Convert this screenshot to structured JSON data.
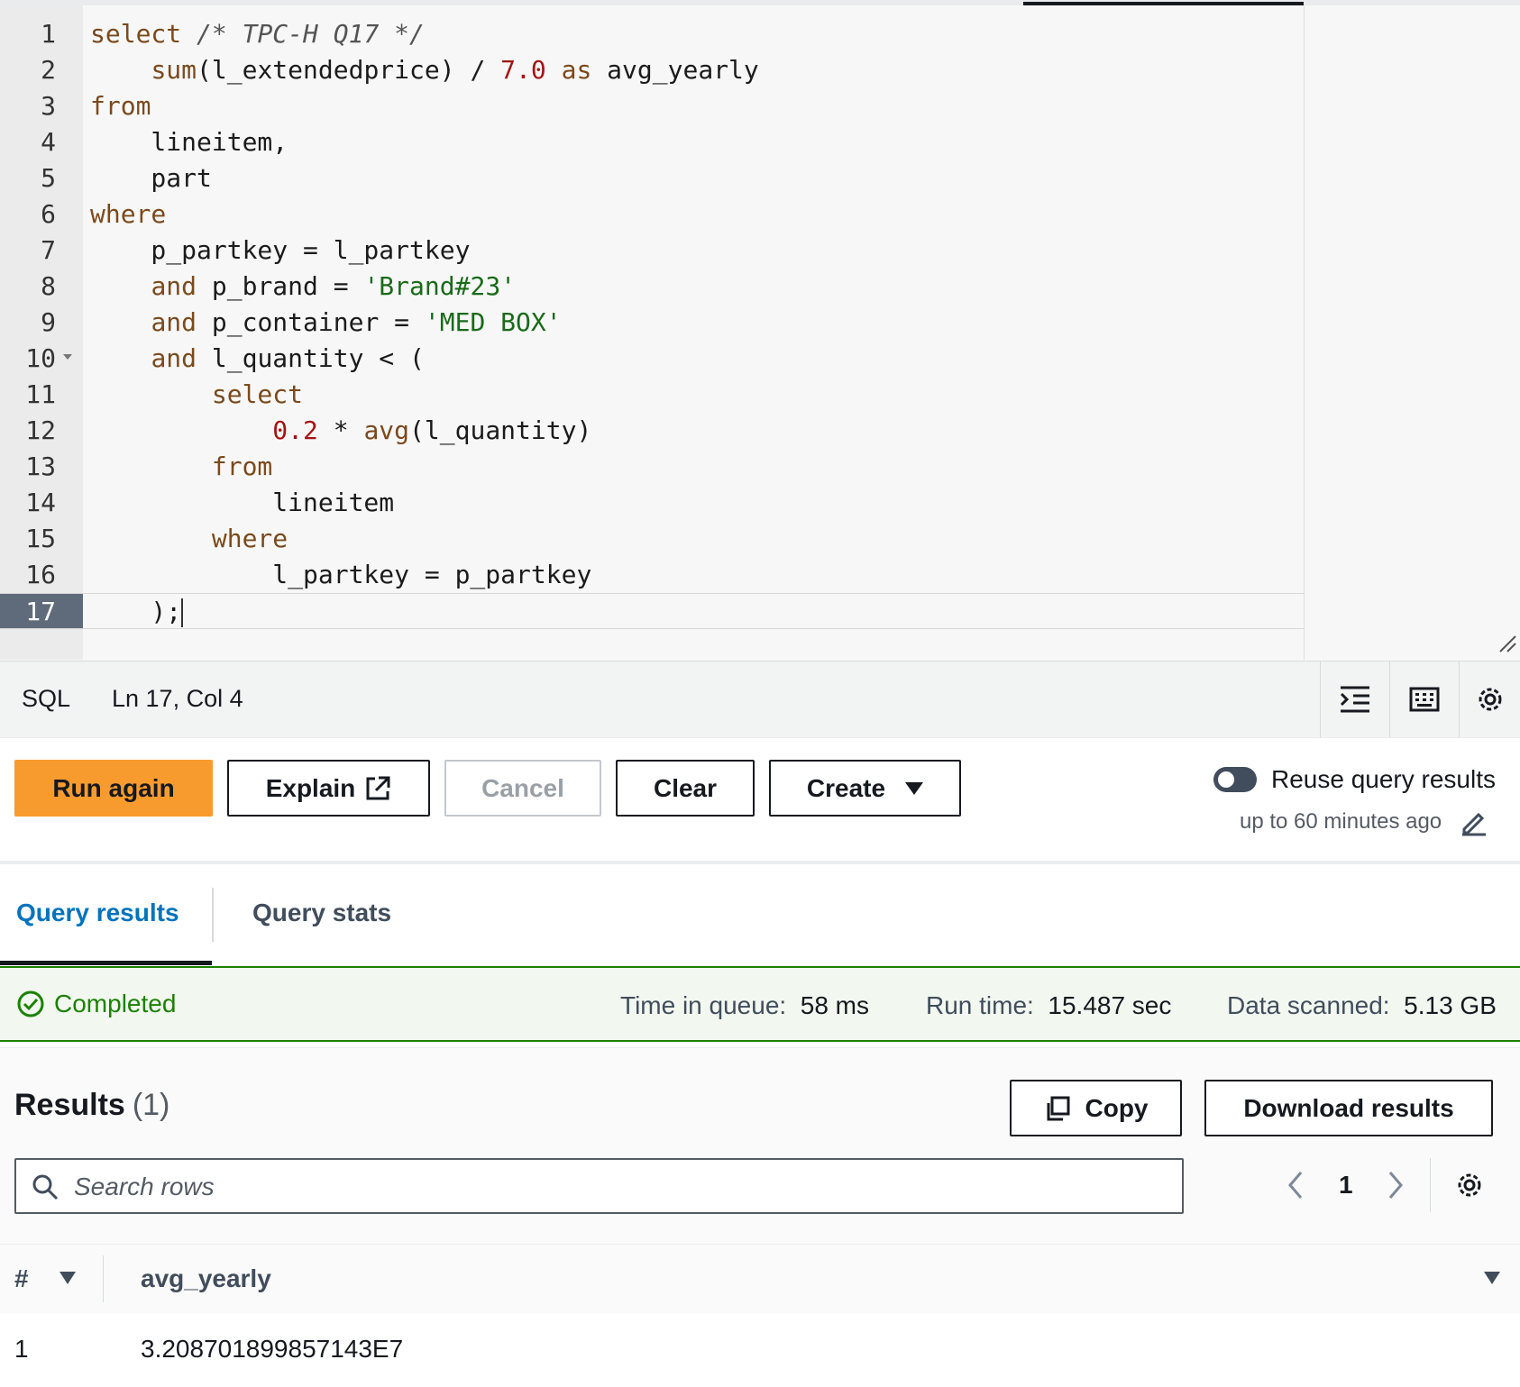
{
  "editor": {
    "lines": [
      {
        "n": "1",
        "tokens": [
          {
            "t": "select",
            "c": "kw"
          },
          {
            "t": " ",
            "c": ""
          },
          {
            "t": "/* TPC-H Q17 */",
            "c": "cm"
          }
        ]
      },
      {
        "n": "2",
        "tokens": [
          {
            "t": "    ",
            "c": ""
          },
          {
            "t": "sum",
            "c": "kw"
          },
          {
            "t": "(l_extendedprice) / ",
            "c": ""
          },
          {
            "t": "7.0",
            "c": "num"
          },
          {
            "t": " ",
            "c": ""
          },
          {
            "t": "as",
            "c": "kw"
          },
          {
            "t": " avg_yearly",
            "c": ""
          }
        ]
      },
      {
        "n": "3",
        "tokens": [
          {
            "t": "from",
            "c": "kw"
          }
        ]
      },
      {
        "n": "4",
        "tokens": [
          {
            "t": "    lineitem,",
            "c": ""
          }
        ]
      },
      {
        "n": "5",
        "tokens": [
          {
            "t": "    part",
            "c": ""
          }
        ]
      },
      {
        "n": "6",
        "tokens": [
          {
            "t": "where",
            "c": "kw"
          }
        ]
      },
      {
        "n": "7",
        "tokens": [
          {
            "t": "    p_partkey = l_partkey",
            "c": ""
          }
        ]
      },
      {
        "n": "8",
        "tokens": [
          {
            "t": "    ",
            "c": ""
          },
          {
            "t": "and",
            "c": "kw"
          },
          {
            "t": " p_brand = ",
            "c": ""
          },
          {
            "t": "'Brand#23'",
            "c": "str"
          }
        ]
      },
      {
        "n": "9",
        "tokens": [
          {
            "t": "    ",
            "c": ""
          },
          {
            "t": "and",
            "c": "kw"
          },
          {
            "t": " p_container = ",
            "c": ""
          },
          {
            "t": "'MED BOX'",
            "c": "str"
          }
        ]
      },
      {
        "n": "10",
        "fold": true,
        "tokens": [
          {
            "t": "    ",
            "c": ""
          },
          {
            "t": "and",
            "c": "kw"
          },
          {
            "t": " l_quantity < (",
            "c": ""
          }
        ]
      },
      {
        "n": "11",
        "tokens": [
          {
            "t": "        ",
            "c": ""
          },
          {
            "t": "select",
            "c": "kw"
          }
        ]
      },
      {
        "n": "12",
        "tokens": [
          {
            "t": "            ",
            "c": ""
          },
          {
            "t": "0.2",
            "c": "num"
          },
          {
            "t": " * ",
            "c": ""
          },
          {
            "t": "avg",
            "c": "kw"
          },
          {
            "t": "(l_quantity)",
            "c": ""
          }
        ]
      },
      {
        "n": "13",
        "tokens": [
          {
            "t": "        ",
            "c": ""
          },
          {
            "t": "from",
            "c": "kw"
          }
        ]
      },
      {
        "n": "14",
        "tokens": [
          {
            "t": "            lineitem",
            "c": ""
          }
        ]
      },
      {
        "n": "15",
        "tokens": [
          {
            "t": "        ",
            "c": ""
          },
          {
            "t": "where",
            "c": "kw"
          }
        ]
      },
      {
        "n": "16",
        "tokens": [
          {
            "t": "            l_partkey = p_partkey",
            "c": ""
          }
        ]
      },
      {
        "n": "17",
        "active": true,
        "tokens": [
          {
            "t": "    );",
            "c": ""
          }
        ]
      }
    ]
  },
  "statusbar": {
    "language": "SQL",
    "position": "Ln 17, Col 4",
    "icons": [
      "indent-icon",
      "keyboard-icon",
      "settings-icon"
    ]
  },
  "actions": {
    "run_again": "Run again",
    "explain": "Explain",
    "cancel": "Cancel",
    "clear": "Clear",
    "create": "Create",
    "reuse_label": "Reuse query results",
    "reuse_sub": "up to 60 minutes ago"
  },
  "tabs": {
    "query_results": "Query results",
    "query_stats": "Query stats"
  },
  "status": {
    "state": "Completed",
    "time_in_queue_label": "Time in queue:",
    "time_in_queue": "58 ms",
    "run_time_label": "Run time:",
    "run_time": "15.487 sec",
    "data_scanned_label": "Data scanned:",
    "data_scanned": "5.13 GB",
    "color_success": "#1d8102"
  },
  "results": {
    "title": "Results",
    "count": "(1)",
    "copy": "Copy",
    "download": "Download results",
    "search_placeholder": "Search rows",
    "page": "1",
    "columns": [
      "#",
      "avg_yearly"
    ],
    "rows": [
      {
        "index": "1",
        "avg_yearly": "3.208701899857143E7"
      }
    ]
  },
  "colors": {
    "accent": "#0073bb",
    "primary_button": "#f89b2e"
  }
}
